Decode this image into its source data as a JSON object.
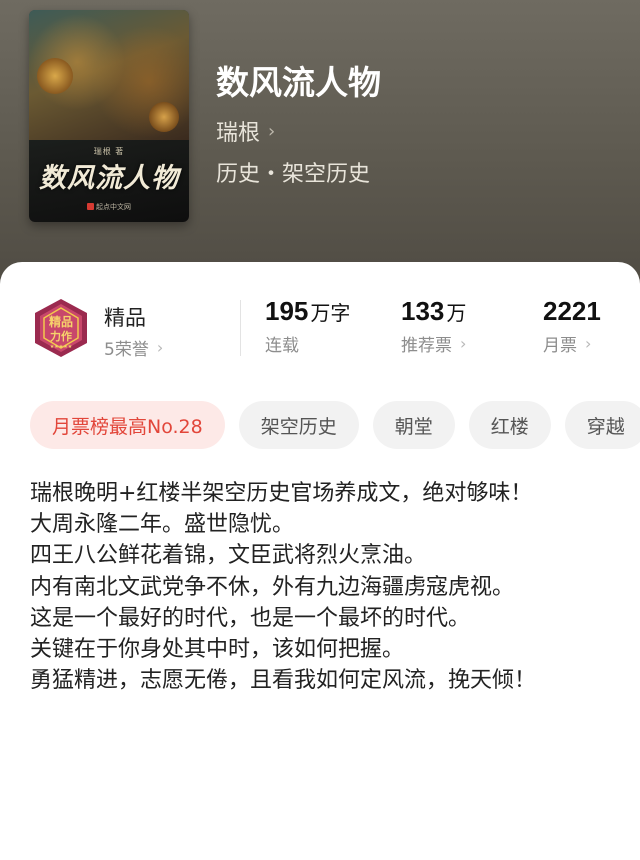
{
  "book": {
    "title": "数风流人物",
    "author": "瑞根",
    "genre": "历史・架空历史",
    "cover": {
      "calligraphy": "数风流人物",
      "small_text": "瑞根 著",
      "publisher": "起点中文网"
    }
  },
  "badge": {
    "label": "精品",
    "honors": "5荣誉",
    "emblem_text": "精品力作",
    "colors": {
      "outer": "#9b2a4f",
      "inner": "#c8476b",
      "gold": "#f2c94c"
    }
  },
  "stats": [
    {
      "num": "195",
      "unit": "万字",
      "label": "连载",
      "has_chevron": false
    },
    {
      "num": "133",
      "unit": "万",
      "label": "推荐票",
      "has_chevron": true
    },
    {
      "num": "2221",
      "unit": "",
      "label": "月票",
      "has_chevron": true
    }
  ],
  "tags": [
    {
      "label": "月票榜最高No.28",
      "highlight": true
    },
    {
      "label": "架空历史",
      "highlight": false
    },
    {
      "label": "朝堂",
      "highlight": false
    },
    {
      "label": "红楼",
      "highlight": false
    },
    {
      "label": "穿越",
      "highlight": false
    }
  ],
  "description": [
    "瑞根晚明+红楼半架空历史官场养成文，绝对够味！",
    "大周永隆二年。盛世隐忧。",
    "四王八公鲜花着锦，文臣武将烈火烹油。",
    "内有南北文武党争不休，外有九边海疆虏寇虎视。",
    "这是一个最好的时代，也是一个最坏的时代。",
    "关键在于你身处其中时，该如何把握。",
    "勇猛精进，志愿无倦，且看我如何定风流，挽天倾！"
  ],
  "icons": {
    "chevron": "chevron-right-icon"
  }
}
